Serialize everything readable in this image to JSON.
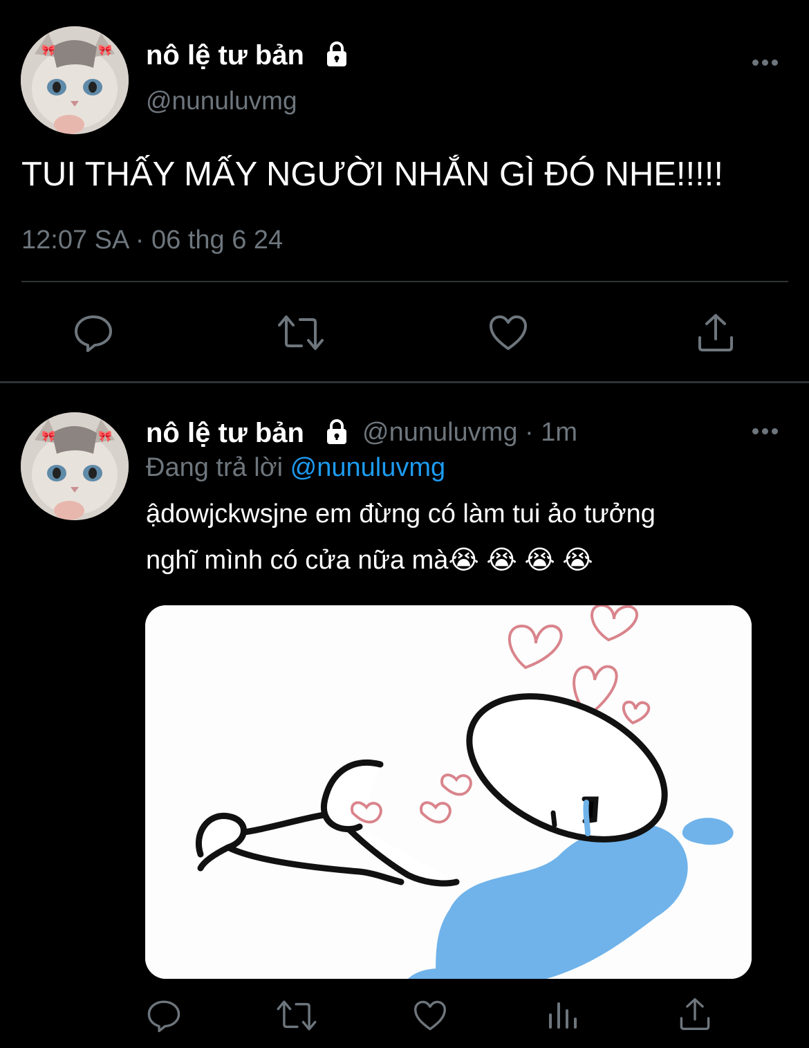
{
  "tweet": {
    "display_name": "nô lệ tư bản",
    "lock_icon": "lock-icon",
    "handle": "@nunuluvmg",
    "text": "TUI THẤY MẤY NGƯỜI NHẮN GÌ ĐÓ NHE!!!!!",
    "timestamp": "12:07 SA · 06 thg 6 24",
    "actions": [
      "reply-icon",
      "retweet-icon",
      "like-icon",
      "share-icon"
    ]
  },
  "reply": {
    "display_name": "nô lệ tư bản",
    "handle": "@nunuluvmg",
    "separator": "·",
    "time": "1m",
    "replying_prefix": "Đang trả lời",
    "replying_to": "@nunuluvmg",
    "text_line1": "ậdowjckwsjne em đừng có làm tui ảo tưởng",
    "text_line2": "nghĩ mình có cửa nữa mà😭 😭 😭 😭",
    "actions": [
      "reply-icon",
      "retweet-icon",
      "like-icon",
      "analytics-icon",
      "share-icon"
    ]
  },
  "colors": {
    "background": "#000000",
    "text": "#ffffff",
    "muted": "#6e767d",
    "link": "#1d9bf0",
    "divider": "#2f3336"
  }
}
